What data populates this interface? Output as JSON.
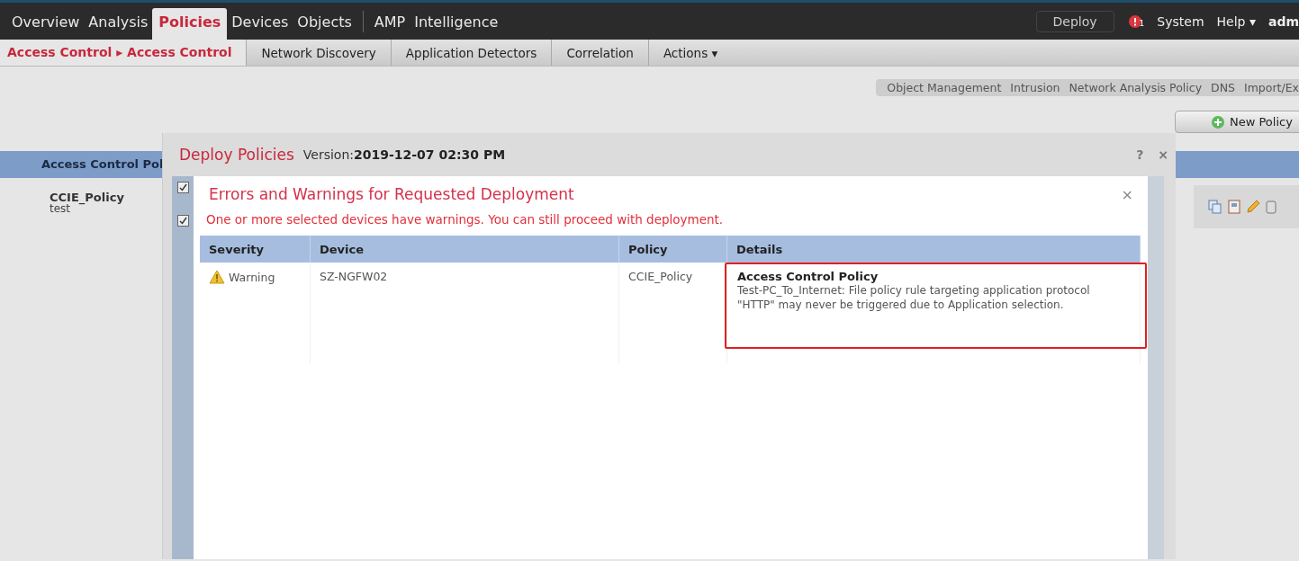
{
  "top_nav": {
    "tabs": [
      {
        "label": "Overview",
        "selected": false,
        "divider_before": false
      },
      {
        "label": "Analysis",
        "selected": false,
        "divider_before": false
      },
      {
        "label": "Policies",
        "selected": true,
        "divider_before": false
      },
      {
        "label": "Devices",
        "selected": false,
        "divider_before": false
      },
      {
        "label": "Objects",
        "selected": false,
        "divider_before": false
      },
      {
        "label": "AMP",
        "selected": false,
        "divider_before": true
      },
      {
        "label": "Intelligence",
        "selected": false,
        "divider_before": false
      }
    ],
    "deploy_button": "Deploy",
    "alert_count": "1",
    "links": [
      "System",
      "Help ▾"
    ],
    "user": "adm"
  },
  "sub_nav": {
    "breadcrumb": "Access Control ▸ Access Control",
    "tabs": [
      "Network Discovery",
      "Application Detectors",
      "Correlation",
      "Actions ▾"
    ]
  },
  "toolbar_links": [
    "Object Management",
    "Intrusion",
    "Network Analysis Policy",
    "DNS",
    "Import/Ex"
  ],
  "new_policy_button": "New Policy",
  "left_panel": {
    "header": "Access Control Pol",
    "items": [
      {
        "name": "CCIE_Policy",
        "description": "test"
      }
    ]
  },
  "dialog": {
    "title": "Deploy Policies",
    "version_label": "Version:",
    "version": "2019-12-07 02:30 PM",
    "help": "?",
    "close": "×",
    "device_rows": [
      {
        "checked": true
      },
      {
        "checked": true
      }
    ],
    "inner": {
      "title": "Errors and Warnings for Requested Deployment",
      "close": "×",
      "message": "One or more selected devices have warnings. You can still proceed with deployment.",
      "table": {
        "columns": [
          "Severity",
          "Device",
          "Policy",
          "Details"
        ],
        "rows": [
          {
            "severity": {
              "kind": "warning",
              "label": "Warning"
            },
            "device": "SZ-NGFW02",
            "policy": "CCIE_Policy",
            "details": {
              "title": "Access Control Policy",
              "text": "Test-PC_To_Internet: File policy rule targeting application protocol \"HTTP\" may never be triggered due to Application selection.",
              "highlighted": true
            }
          }
        ]
      }
    }
  }
}
